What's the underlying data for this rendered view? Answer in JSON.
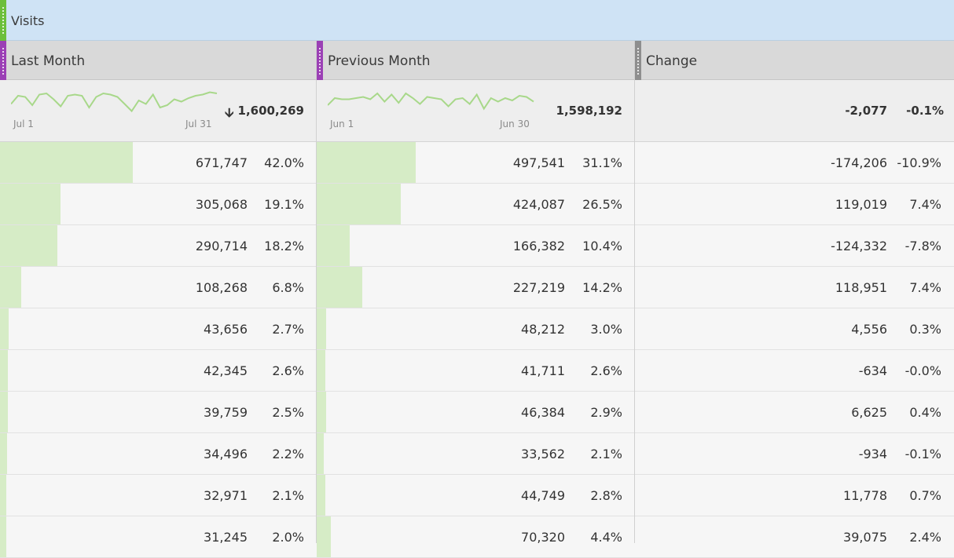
{
  "metric": {
    "title": "Visits",
    "handle_color": "#6cbf3b",
    "header_bg": "#cfe3f5"
  },
  "columns": [
    {
      "label": "Last Month",
      "handle_color": "#9b40b5"
    },
    {
      "label": "Previous Month",
      "handle_color": "#9b40b5"
    },
    {
      "label": "Change",
      "handle_color": "#8e8e8e"
    }
  ],
  "summary": {
    "last_month": {
      "start_label": "Jul 1",
      "end_label": "Jul 31",
      "total": "1,600,269",
      "trend_icon": "down-arrow-icon",
      "sparkline": [
        0.55,
        0.2,
        0.25,
        0.6,
        0.15,
        0.1,
        0.35,
        0.65,
        0.2,
        0.15,
        0.2,
        0.7,
        0.25,
        0.1,
        0.15,
        0.25,
        0.55,
        0.85,
        0.4,
        0.55,
        0.15,
        0.7,
        0.6,
        0.35,
        0.45,
        0.3,
        0.2,
        0.15,
        0.05,
        0.1
      ]
    },
    "previous_month": {
      "start_label": "Jun 1",
      "end_label": "Jun 30",
      "total": "1,598,192",
      "sparkline": [
        0.6,
        0.3,
        0.35,
        0.35,
        0.3,
        0.25,
        0.35,
        0.1,
        0.45,
        0.15,
        0.5,
        0.1,
        0.3,
        0.55,
        0.25,
        0.3,
        0.35,
        0.65,
        0.35,
        0.3,
        0.55,
        0.15,
        0.75,
        0.3,
        0.45,
        0.3,
        0.4,
        0.2,
        0.25,
        0.45
      ]
    },
    "change": {
      "value": "-2,077",
      "pct": "-0.1%"
    }
  },
  "rows": [
    {
      "last": "671,747",
      "last_pct": "42.0%",
      "last_share": 0.42,
      "prev": "497,541",
      "prev_pct": "31.1%",
      "prev_share": 0.311,
      "change": "-174,206",
      "change_pct": "-10.9%"
    },
    {
      "last": "305,068",
      "last_pct": "19.1%",
      "last_share": 0.191,
      "prev": "424,087",
      "prev_pct": "26.5%",
      "prev_share": 0.265,
      "change": "119,019",
      "change_pct": "7.4%"
    },
    {
      "last": "290,714",
      "last_pct": "18.2%",
      "last_share": 0.182,
      "prev": "166,382",
      "prev_pct": "10.4%",
      "prev_share": 0.104,
      "change": "-124,332",
      "change_pct": "-7.8%"
    },
    {
      "last": "108,268",
      "last_pct": "6.8%",
      "last_share": 0.068,
      "prev": "227,219",
      "prev_pct": "14.2%",
      "prev_share": 0.142,
      "change": "118,951",
      "change_pct": "7.4%"
    },
    {
      "last": "43,656",
      "last_pct": "2.7%",
      "last_share": 0.027,
      "prev": "48,212",
      "prev_pct": "3.0%",
      "prev_share": 0.03,
      "change": "4,556",
      "change_pct": "0.3%"
    },
    {
      "last": "42,345",
      "last_pct": "2.6%",
      "last_share": 0.026,
      "prev": "41,711",
      "prev_pct": "2.6%",
      "prev_share": 0.026,
      "change": "-634",
      "change_pct": "-0.0%"
    },
    {
      "last": "39,759",
      "last_pct": "2.5%",
      "last_share": 0.025,
      "prev": "46,384",
      "prev_pct": "2.9%",
      "prev_share": 0.029,
      "change": "6,625",
      "change_pct": "0.4%"
    },
    {
      "last": "34,496",
      "last_pct": "2.2%",
      "last_share": 0.022,
      "prev": "33,562",
      "prev_pct": "2.1%",
      "prev_share": 0.021,
      "change": "-934",
      "change_pct": "-0.1%"
    },
    {
      "last": "32,971",
      "last_pct": "2.1%",
      "last_share": 0.021,
      "prev": "44,749",
      "prev_pct": "2.8%",
      "prev_share": 0.028,
      "change": "11,778",
      "change_pct": "0.7%"
    },
    {
      "last": "31,245",
      "last_pct": "2.0%",
      "last_share": 0.02,
      "prev": "70,320",
      "prev_pct": "4.4%",
      "prev_share": 0.044,
      "change": "39,075",
      "change_pct": "2.4%"
    }
  ],
  "colors": {
    "bar": "#d6ecc6",
    "sparkline": "#a8d88a",
    "column_header_bg": "#d9d9d9",
    "summary_bg": "#eeeeee",
    "row_bg": "#f6f6f6"
  }
}
